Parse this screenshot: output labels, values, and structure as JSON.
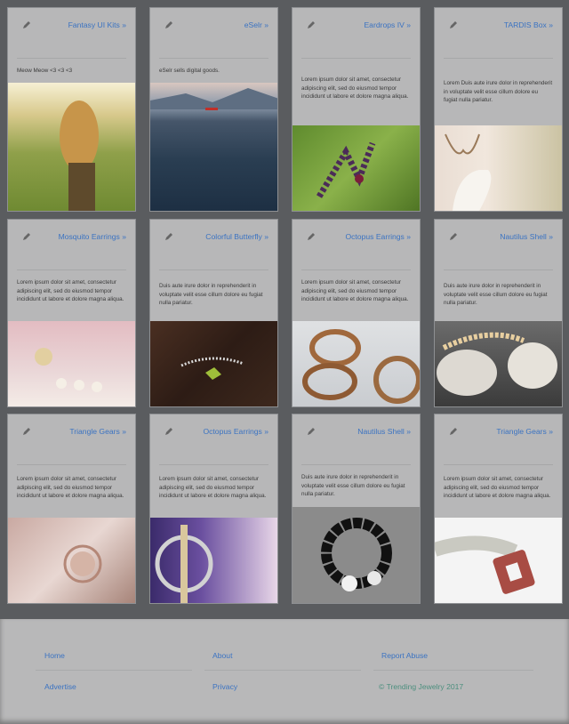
{
  "cards": [
    {
      "title": "Fantasy UI Kits »",
      "desc": "Meow Meow <3 <3 <3",
      "image": "woman-in-sunlit-field"
    },
    {
      "title": "eSelr »",
      "desc": "eSelr sells digital goods.",
      "image": "ocean-waves-mountains"
    },
    {
      "title": "Eardrops IV »",
      "desc": "Lorem ipsum dolor sit amet, consectetur adipiscing elit, sed do eiusmod tempor incididunt ut labore et dolore magna aliqua.",
      "image": "purple-beaded-earrings"
    },
    {
      "title": "TARDIS Box »",
      "desc": "Lorem Duis aute irure dolor in reprehenderit in voluptate velit esse cillum dolore eu fugiat nulla pariatur.",
      "image": "bride-with-necklace"
    },
    {
      "title": "Mosquito Earrings »",
      "desc": "Lorem ipsum dolor sit amet, consectetur adipiscing elit, sed do eiusmod tempor incididunt ut labore et dolore magna aliqua.",
      "image": "pearl-ring-pink"
    },
    {
      "title": "Colorful Butterfly »",
      "desc": "Duis aute irure dolor in reprehenderit in voluptate velit esse cillum dolore eu fugiat nulla pariatur.",
      "image": "silver-bracelet-wood"
    },
    {
      "title": "Octopus Earrings »",
      "desc": "Lorem ipsum dolor sit amet, consectetur adipiscing elit, sed do eiusmod tempor incididunt ut labore et dolore magna aliqua.",
      "image": "gold-rings"
    },
    {
      "title": "Nautilus Shell »",
      "desc": "Duis aute irure dolor in reprehenderit in voluptate velit esse cillum dolore eu fugiat nulla pariatur.",
      "image": "pearls-on-stones"
    },
    {
      "title": "Triangle Gears »",
      "desc": "Lorem ipsum dolor sit amet, consectetur adipiscing elit, sed do eiusmod tempor incididunt ut labore et dolore magna aliqua.",
      "image": "rose-gold-ring"
    },
    {
      "title": "Octopus Earrings »",
      "desc": "Lorem ipsum dolor sit amet, consectetur adipiscing elit, sed do eiusmod tempor incididunt ut labore et dolore magna aliqua.",
      "image": "hoop-earring"
    },
    {
      "title": "Nautilus Shell »",
      "desc": "Duis aute irure dolor in reprehenderit in voluptate velit esse cillum dolore eu fugiat nulla pariatur.",
      "image": "black-white-bead-bracelet"
    },
    {
      "title": "Triangle Gears »",
      "desc": "Lorem ipsum dolor sit amet, consectetur adipiscing elit, sed do eiusmod tempor incididunt ut labore et dolore magna aliqua.",
      "image": "concrete-bracelet-pendant"
    }
  ],
  "footer": {
    "home": "Home",
    "about": "About",
    "report": "Report Abuse",
    "advertise": "Advertise",
    "privacy": "Privacy",
    "copyright": "© Trending Jewelry 2017"
  },
  "colors": {
    "link": "#3b73c2",
    "copyright": "#4c8f7e",
    "card": "#b7b7b8",
    "page": "#5a5c5f"
  }
}
